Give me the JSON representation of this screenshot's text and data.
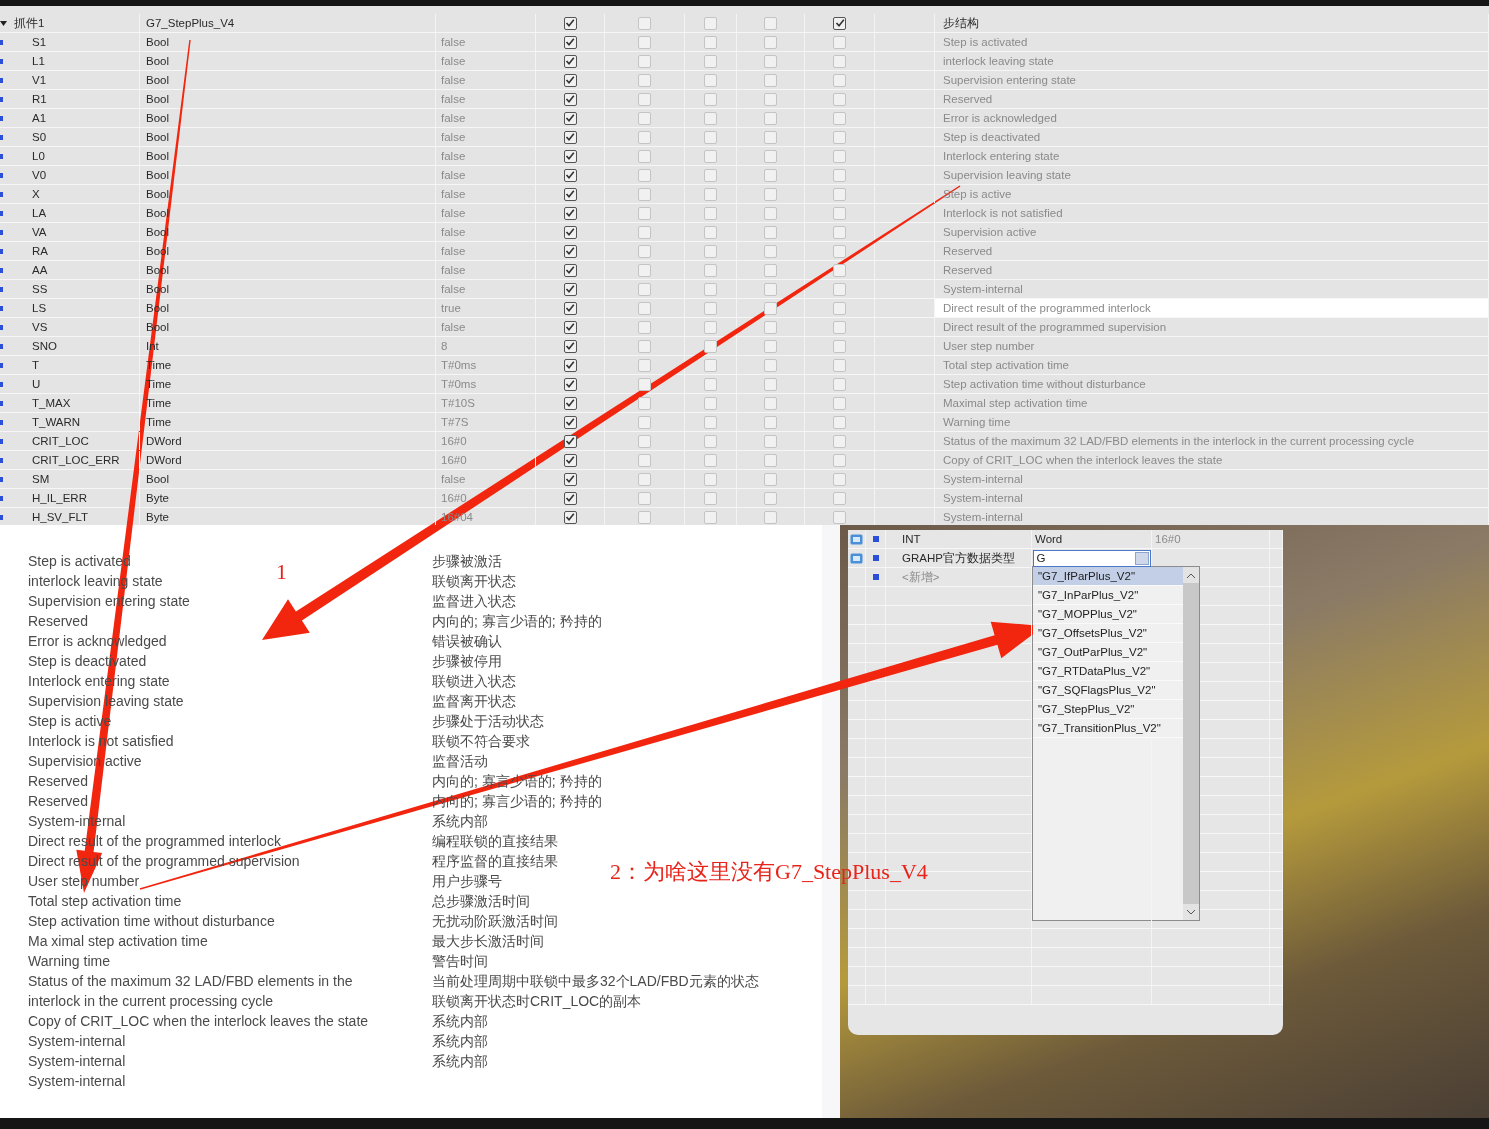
{
  "variable_table": {
    "group": {
      "name": "抓件1",
      "type": "G7_StepPlus_V4",
      "expanded": true,
      "flags": [
        true,
        false,
        false,
        false,
        true
      ],
      "comment": "步结构"
    },
    "rows": [
      {
        "name": "S1",
        "type": "Bool",
        "default": "false",
        "flags": [
          true,
          false,
          false,
          false,
          false
        ],
        "comment": "Step is activated",
        "selected": false
      },
      {
        "name": "L1",
        "type": "Bool",
        "default": "false",
        "flags": [
          true,
          false,
          false,
          false,
          false
        ],
        "comment": "interlock leaving state",
        "selected": false
      },
      {
        "name": "V1",
        "type": "Bool",
        "default": "false",
        "flags": [
          true,
          false,
          false,
          false,
          false
        ],
        "comment": "Supervision entering state",
        "selected": false
      },
      {
        "name": "R1",
        "type": "Bool",
        "default": "false",
        "flags": [
          true,
          false,
          false,
          false,
          false
        ],
        "comment": "Reserved",
        "selected": false
      },
      {
        "name": "A1",
        "type": "Bool",
        "default": "false",
        "flags": [
          true,
          false,
          false,
          false,
          false
        ],
        "comment": "Error is acknowledged",
        "selected": false
      },
      {
        "name": "S0",
        "type": "Bool",
        "default": "false",
        "flags": [
          true,
          false,
          false,
          false,
          false
        ],
        "comment": "Step is deactivated",
        "selected": false
      },
      {
        "name": "L0",
        "type": "Bool",
        "default": "false",
        "flags": [
          true,
          false,
          false,
          false,
          false
        ],
        "comment": "Interlock entering state",
        "selected": false
      },
      {
        "name": "V0",
        "type": "Bool",
        "default": "false",
        "flags": [
          true,
          false,
          false,
          false,
          false
        ],
        "comment": "Supervision leaving state",
        "selected": false
      },
      {
        "name": "X",
        "type": "Bool",
        "default": "false",
        "flags": [
          true,
          false,
          false,
          false,
          false
        ],
        "comment": "Step is active",
        "selected": false
      },
      {
        "name": "LA",
        "type": "Bool",
        "default": "false",
        "flags": [
          true,
          false,
          false,
          false,
          false
        ],
        "comment": "Interlock is not satisfied",
        "selected": false
      },
      {
        "name": "VA",
        "type": "Bool",
        "default": "false",
        "flags": [
          true,
          false,
          false,
          false,
          false
        ],
        "comment": "Supervision active",
        "selected": false
      },
      {
        "name": "RA",
        "type": "Bool",
        "default": "false",
        "flags": [
          true,
          false,
          false,
          false,
          false
        ],
        "comment": "Reserved",
        "selected": false
      },
      {
        "name": "AA",
        "type": "Bool",
        "default": "false",
        "flags": [
          true,
          false,
          false,
          false,
          false
        ],
        "comment": "Reserved",
        "selected": false
      },
      {
        "name": "SS",
        "type": "Bool",
        "default": "false",
        "flags": [
          true,
          false,
          false,
          false,
          false
        ],
        "comment": "System-internal",
        "selected": false
      },
      {
        "name": "LS",
        "type": "Bool",
        "default": "true",
        "flags": [
          true,
          false,
          false,
          false,
          false
        ],
        "comment": "Direct result of the programmed interlock",
        "selected": true
      },
      {
        "name": "VS",
        "type": "Bool",
        "default": "false",
        "flags": [
          true,
          false,
          false,
          false,
          false
        ],
        "comment": "Direct result of the programmed supervision",
        "selected": false
      },
      {
        "name": "SNO",
        "type": "Int",
        "default": "8",
        "flags": [
          true,
          false,
          false,
          false,
          false
        ],
        "comment": "User step number",
        "selected": false
      },
      {
        "name": "T",
        "type": "Time",
        "default": "T#0ms",
        "flags": [
          true,
          false,
          false,
          false,
          false
        ],
        "comment": "Total step activation time",
        "selected": false
      },
      {
        "name": "U",
        "type": "Time",
        "default": "T#0ms",
        "flags": [
          true,
          false,
          false,
          false,
          false
        ],
        "comment": "Step activation time without disturbance",
        "selected": false
      },
      {
        "name": "T_MAX",
        "type": "Time",
        "default": "T#10S",
        "flags": [
          true,
          false,
          false,
          false,
          false
        ],
        "comment": "Maximal step activation time",
        "selected": false
      },
      {
        "name": "T_WARN",
        "type": "Time",
        "default": "T#7S",
        "flags": [
          true,
          false,
          false,
          false,
          false
        ],
        "comment": "Warning time",
        "selected": false
      },
      {
        "name": "CRIT_LOC",
        "type": "DWord",
        "default": "16#0",
        "flags": [
          true,
          false,
          false,
          false,
          false
        ],
        "comment": "Status of the maximum 32 LAD/FBD elements in the interlock in the current processing cycle",
        "selected": false
      },
      {
        "name": "CRIT_LOC_ERR",
        "type": "DWord",
        "default": "16#0",
        "flags": [
          true,
          false,
          false,
          false,
          false
        ],
        "comment": "Copy of CRIT_LOC when the interlock leaves the state",
        "selected": false
      },
      {
        "name": "SM",
        "type": "Bool",
        "default": "false",
        "flags": [
          true,
          false,
          false,
          false,
          false
        ],
        "comment": "System-internal",
        "selected": false
      },
      {
        "name": "H_IL_ERR",
        "type": "Byte",
        "default": "16#0",
        "flags": [
          true,
          false,
          false,
          false,
          false
        ],
        "comment": "System-internal",
        "selected": false
      },
      {
        "name": "H_SV_FLT",
        "type": "Byte",
        "default": "16#04",
        "flags": [
          true,
          false,
          false,
          false,
          false
        ],
        "comment": "System-internal",
        "selected": false
      }
    ]
  },
  "translation_panel": {
    "english": [
      "Step is activated",
      "interlock leaving state",
      "Supervision entering state",
      "Reserved",
      "Error is acknowledged",
      "Step is deactivated",
      "Interlock entering state",
      "Supervision leaving state",
      "Step is active",
      "Interlock is not satisfied",
      "Supervision active",
      "Reserved",
      "Reserved",
      "System-internal",
      "Direct result of the programmed interlock",
      "Direct result of the programmed supervision",
      "User step number",
      "Total step activation time",
      "Step activation time without disturbance",
      "Ma ximal step activation time",
      "Warning time",
      "Status of the maximum 32 LAD/FBD elements in the interlock in the current processing cycle",
      "Copy of CRIT_LOC when the interlock leaves the state",
      "System-internal",
      "System-internal",
      "System-internal"
    ],
    "chinese": [
      "步骤被激活",
      "联锁离开状态",
      "监督进入状态",
      "内向的; 寡言少语的; 矜持的",
      "错误被确认",
      "步骤被停用",
      "联锁进入状态",
      "监督离开状态",
      "步骤处于活动状态",
      "联锁不符合要求",
      "监督活动",
      "内向的; 寡言少语的; 矜持的",
      "内向的; 寡言少语的; 矜持的",
      "系统内部",
      "编程联锁的直接结果",
      "程序监督的直接结果",
      "用户步骤号",
      "总步骤激活时间",
      "无扰动阶跃激活时间",
      "最大步长激活时间",
      "警告时间",
      "当前处理周期中联锁中最多32个LAD/FBD元素的状态",
      "联锁离开状态时CRIT_LOC的副本",
      "系统内部",
      "系统内部",
      "系统内部"
    ]
  },
  "annotations": {
    "label_1": "1",
    "label_2": "2：为啥这里没有G7_StepPlus_V4"
  },
  "dialog": {
    "rows": [
      {
        "kind": "member",
        "name": "INT",
        "type": "Word",
        "default": "16#0"
      },
      {
        "kind": "editing",
        "name": "GRAHP官方数据类型",
        "value": "G"
      },
      {
        "kind": "add",
        "name": "<新增>"
      }
    ],
    "dropdown": {
      "options": [
        {
          "label": "\"G7_IfParPlus_V2\"",
          "selected": true
        },
        {
          "label": "\"G7_InParPlus_V2\"",
          "selected": false
        },
        {
          "label": "\"G7_MOPPlus_V2\"",
          "selected": false
        },
        {
          "label": "\"G7_OffsetsPlus_V2\"",
          "selected": false
        },
        {
          "label": "\"G7_OutParPlus_V2\"",
          "selected": false
        },
        {
          "label": "\"G7_RTDataPlus_V2\"",
          "selected": false
        },
        {
          "label": "\"G7_SQFlagsPlus_V2\"",
          "selected": false
        },
        {
          "label": "\"G7_StepPlus_V2\"",
          "selected": false
        },
        {
          "label": "\"G7_TransitionPlus_V2\"",
          "selected": false
        }
      ]
    }
  }
}
